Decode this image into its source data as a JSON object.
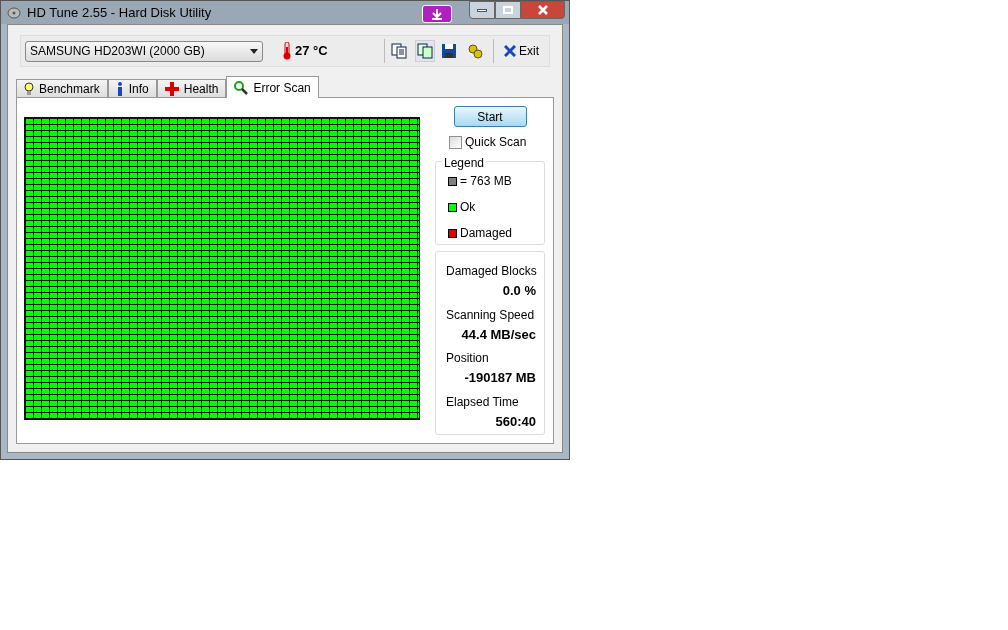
{
  "window": {
    "title": "HD Tune 2.55 - Hard Disk Utility"
  },
  "toolbar": {
    "drive": "SAMSUNG HD203WI (2000 GB)",
    "temperature": "27 °C",
    "exit_label": "Exit"
  },
  "tabs": [
    {
      "label": "Benchmark",
      "kind": "benchmark",
      "selected": false
    },
    {
      "label": "Info",
      "kind": "info",
      "selected": false
    },
    {
      "label": "Health",
      "kind": "health",
      "selected": false
    },
    {
      "label": "Error Scan",
      "kind": "scan",
      "selected": true
    }
  ],
  "controls": {
    "start_button": "Start",
    "quick_scan": {
      "label": "Quick Scan",
      "checked": false
    }
  },
  "legend": {
    "title": "Legend",
    "items": [
      {
        "kind": "size",
        "label": "= 763 MB",
        "color": "#808080"
      },
      {
        "kind": "ok",
        "label": "Ok",
        "color": "#00ff00"
      },
      {
        "kind": "damaged",
        "label": "Damaged",
        "color": "#e00000"
      }
    ]
  },
  "stats": [
    {
      "label": "Damaged Blocks",
      "value": "0.0 %"
    },
    {
      "label": "Scanning Speed",
      "value": "44.4 MB/sec"
    },
    {
      "label": "Position",
      "value": "-190187 MB"
    },
    {
      "label": "Elapsed Time",
      "value": "560:40"
    }
  ]
}
